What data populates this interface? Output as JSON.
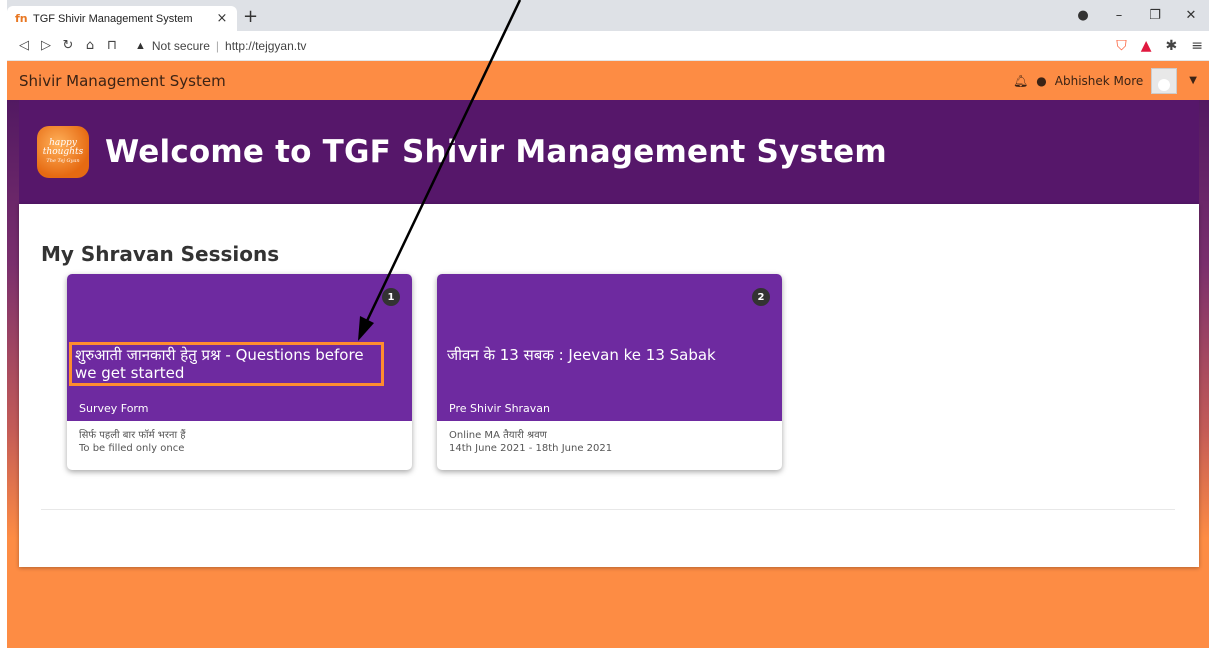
{
  "browser": {
    "tab_title": "TGF Shivir Management System",
    "favicon": "fn",
    "new_tab": "+",
    "close_tab": "×",
    "security_label": "Not secure",
    "url": "http://tejgyan.tv"
  },
  "app": {
    "brand": "Shivir Management System",
    "user_name": "Abhishek More",
    "welcome_title": "Welcome to TGF Shivir Management System",
    "logo_text_1": "happy",
    "logo_text_2": "thoughts",
    "logo_text_3": "The Tej Gyan"
  },
  "main": {
    "section_title": "My Shravan Sessions",
    "cards": [
      {
        "badge": "1",
        "title": "शुरुआती जानकारी हेतु प्रश्न - Questions before we get started",
        "subtitle": "Survey Form",
        "line1": "सिर्फ पहली बार फॉर्म भरना हैं",
        "line2": "To be filled only once"
      },
      {
        "badge": "2",
        "title": "जीवन के 13 सबक : Jeevan ke 13 Sabak",
        "subtitle": "Pre Shivir Shravan",
        "line1": "Online MA तैयारी श्रवण",
        "line2": "14th June 2021 - 18th June 2021"
      }
    ]
  },
  "colors": {
    "nav_orange": "#fd8c44",
    "hero_purple": "#56176a",
    "card_purple": "#6e2aa0",
    "highlight_orange": "#ff8c2e"
  }
}
